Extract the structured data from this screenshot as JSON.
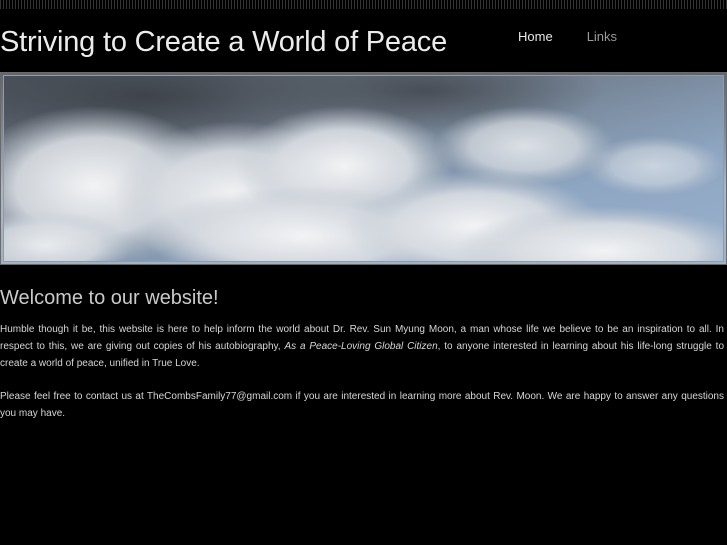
{
  "header": {
    "site_title": "Striving to Create a World of Peace"
  },
  "nav": {
    "items": [
      {
        "label": "Home"
      },
      {
        "label": "Links"
      }
    ]
  },
  "banner": {
    "alt_subject": "cloudy sky"
  },
  "main": {
    "heading": "Welcome to our website!",
    "paragraph1": {
      "before": "Humble though it be, this website is here to help inform the world about Dr. Rev. Sun Myung Moon, a man whose life we believe to be an inspiration to all. In respect to this, we are giving out copies of his autobiography, ",
      "book_title": "As a Peace-Loving Global Citizen",
      "after": ", to anyone interested in learning about his life-long struggle to create a world of peace, unified in True Love."
    },
    "paragraph2": "Please feel free to contact us at TheCombsFamily77@gmail.com if you are interested in learning more about Rev. Moon. We are happy to answer any questions you may have."
  },
  "colors": {
    "background": "#000000",
    "title_text": "#ececec",
    "body_text": "#d6d6d6",
    "nav_active": "#e8e8e8",
    "nav_inactive": "#9a9a9a"
  }
}
